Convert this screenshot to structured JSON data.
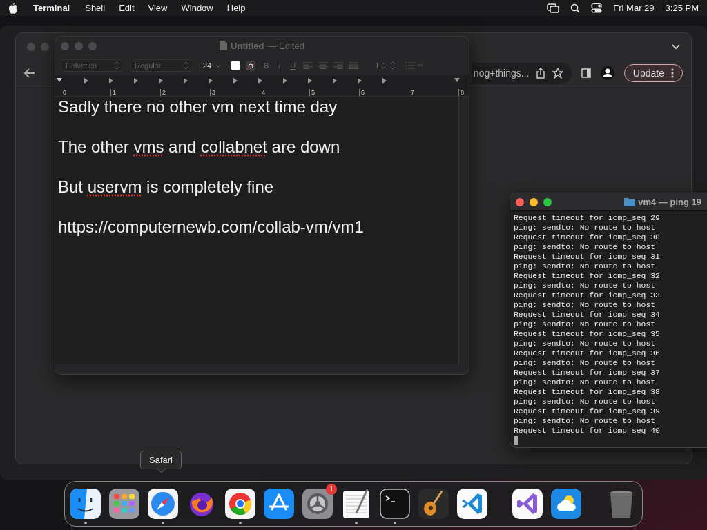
{
  "menu_bar": {
    "app_name": "Terminal",
    "menus": [
      "Shell",
      "Edit",
      "View",
      "Window",
      "Help"
    ],
    "date": "Fri Mar 29",
    "time": "3:25 PM"
  },
  "browser_window": {
    "address_text": "nog+things...",
    "update_button": "Update"
  },
  "textedit_window": {
    "title": "Untitled",
    "status": "— Edited",
    "font": "Helvetica",
    "style": "Regular",
    "size": "24",
    "format_buttons": [
      "B",
      "I",
      "U"
    ],
    "line_spacing": "1.0",
    "ruler_numbers": [
      "0",
      "1",
      "2",
      "3",
      "4",
      "5",
      "6",
      "7",
      "8"
    ],
    "paragraphs": [
      [
        {
          "text": "Sadly there no other vm next time day",
          "misspelled": false
        }
      ],
      [
        {
          "text": "The other ",
          "misspelled": false
        },
        {
          "text": "vms",
          "misspelled": true
        },
        {
          "text": " and ",
          "misspelled": false
        },
        {
          "text": "collabnet",
          "misspelled": true
        },
        {
          "text": " are down",
          "misspelled": false
        }
      ],
      [
        {
          "text": "But ",
          "misspelled": false
        },
        {
          "text": "uservm",
          "misspelled": true
        },
        {
          "text": " is completely fine",
          "misspelled": false
        }
      ],
      [
        {
          "text": "https://computernewb.com/collab-vm/vm1",
          "misspelled": false
        }
      ]
    ]
  },
  "terminal_window": {
    "title": "vm4 — ping 19",
    "lines": [
      "Request timeout for icmp_seq 29",
      "ping: sendto: No route to host",
      "Request timeout for icmp_seq 30",
      "ping: sendto: No route to host",
      "Request timeout for icmp_seq 31",
      "ping: sendto: No route to host",
      "Request timeout for icmp_seq 32",
      "ping: sendto: No route to host",
      "Request timeout for icmp_seq 33",
      "ping: sendto: No route to host",
      "Request timeout for icmp_seq 34",
      "ping: sendto: No route to host",
      "Request timeout for icmp_seq 35",
      "ping: sendto: No route to host",
      "Request timeout for icmp_seq 36",
      "ping: sendto: No route to host",
      "Request timeout for icmp_seq 37",
      "ping: sendto: No route to host",
      "Request timeout for icmp_seq 38",
      "ping: sendto: No route to host",
      "Request timeout for icmp_seq 39",
      "ping: sendto: No route to host",
      "Request timeout for icmp_seq 40"
    ]
  },
  "tooltip": "Safari",
  "dock": {
    "groups": [
      [
        {
          "kind": "finder",
          "running": true
        },
        {
          "kind": "launchpad",
          "running": false
        },
        {
          "kind": "safari",
          "running": true
        },
        {
          "kind": "firefox",
          "running": false
        },
        {
          "kind": "chrome",
          "running": true
        },
        {
          "kind": "appstore",
          "running": false
        },
        {
          "kind": "settings",
          "running": false,
          "badge": "1"
        },
        {
          "kind": "textedit",
          "running": true
        },
        {
          "kind": "terminal",
          "running": true
        },
        {
          "kind": "garageband",
          "running": false
        },
        {
          "kind": "vscode",
          "running": false
        }
      ],
      [
        {
          "kind": "visualstudio",
          "running": false
        },
        {
          "kind": "weather",
          "running": false
        }
      ],
      [
        {
          "kind": "trash",
          "running": false
        }
      ]
    ]
  }
}
